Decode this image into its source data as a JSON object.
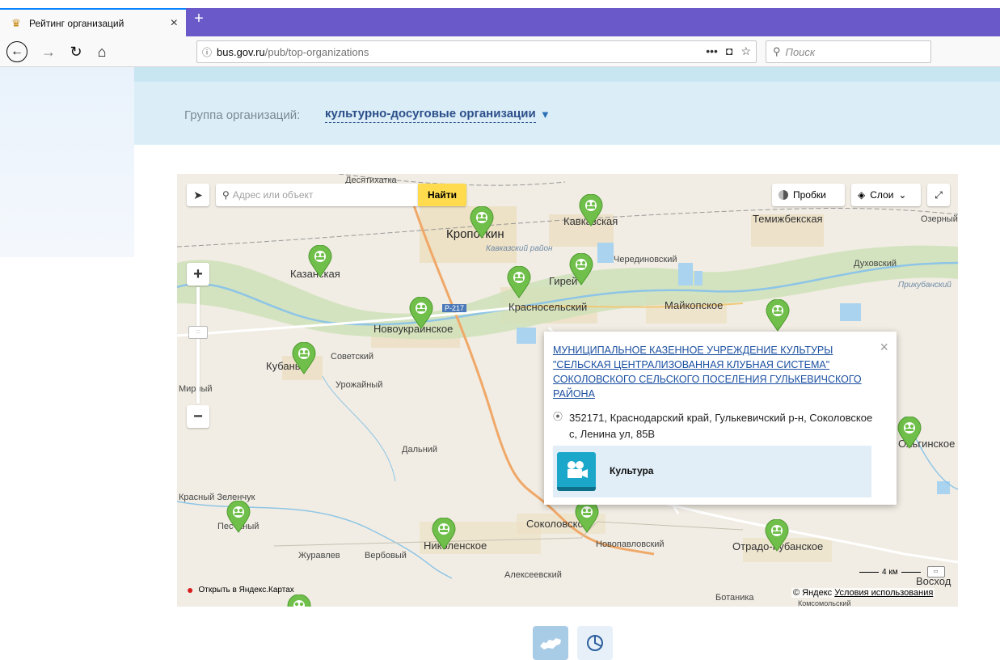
{
  "browser": {
    "tab_title": "Рейтинг организаций",
    "tab_close": "×",
    "new_tab": "+",
    "url_host": "bus.gov.ru",
    "url_path": "/pub/top-organizations",
    "url_more": "•••",
    "search_placeholder": "Поиск"
  },
  "group": {
    "label": "Группа организаций:",
    "value": "культурно-досуговые организации",
    "arrow": "▼"
  },
  "map": {
    "search_placeholder": "Адрес или объект",
    "find_button": "Найти",
    "traffic_label": "Пробки",
    "layers_label": "Слои",
    "open_in_yandex": "Открыть в Яндекс.Картах",
    "scale_label": "4 км",
    "copyright": "© Яндекс",
    "terms": "Условия использования",
    "places": [
      {
        "text": "Десятихатка",
        "cls": ""
      },
      {
        "text": "Кропоткин",
        "cls": "big"
      },
      {
        "text": "Кавказский район",
        "cls": "it"
      },
      {
        "text": "Кавказская",
        "cls": "md"
      },
      {
        "text": "Темижбекская",
        "cls": "md"
      },
      {
        "text": "Озерный",
        "cls": ""
      },
      {
        "text": "Казанская",
        "cls": "md"
      },
      {
        "text": "Гирей",
        "cls": "md"
      },
      {
        "text": "Черединовский",
        "cls": ""
      },
      {
        "text": "Духовский",
        "cls": ""
      },
      {
        "text": "Прикубанский",
        "cls": "it"
      },
      {
        "text": "Р-217",
        "cls": ""
      },
      {
        "text": "Красносельский",
        "cls": "md"
      },
      {
        "text": "Майкопское",
        "cls": "md"
      },
      {
        "text": "Новоукраинское",
        "cls": "md"
      },
      {
        "text": "Советский",
        "cls": ""
      },
      {
        "text": "Кубань",
        "cls": "md"
      },
      {
        "text": "Урожайный",
        "cls": ""
      },
      {
        "text": "Мирный",
        "cls": ""
      },
      {
        "text": "Дальний",
        "cls": ""
      },
      {
        "text": "Ольгинское",
        "cls": "md"
      },
      {
        "text": "Красный Зеленчук",
        "cls": ""
      },
      {
        "text": "Песчаный",
        "cls": ""
      },
      {
        "text": "Николенское",
        "cls": "md"
      },
      {
        "text": "Соколовское",
        "cls": "md"
      },
      {
        "text": "Новопавловский",
        "cls": ""
      },
      {
        "text": "Отрадо-Кубанское",
        "cls": "md"
      },
      {
        "text": "Журавлев",
        "cls": ""
      },
      {
        "text": "Вербовый",
        "cls": ""
      },
      {
        "text": "Алексеевский",
        "cls": ""
      },
      {
        "text": "Ботаника",
        "cls": ""
      },
      {
        "text": "Комсомольский",
        "cls": ""
      },
      {
        "text": "Восход",
        "cls": ""
      }
    ]
  },
  "popup": {
    "title": "МУНИЦИПАЛЬНОЕ КАЗЕННОЕ УЧРЕЖДЕНИЕ КУЛЬТУРЫ \"СЕЛЬСКАЯ ЦЕНТРАЛИЗОВАННАЯ КЛУБНАЯ СИСТЕМА\" СОКОЛОВСКОГО СЕЛЬСКОГО ПОСЕЛЕНИЯ ГУЛЬКЕВИЧСКОГО РАЙОНА",
    "address": "352171, Краснодарский край, Гулькевичский р-н, Соколовское с, Ленина ул, 85В",
    "category": "Культура",
    "close": "×"
  },
  "colors": {
    "marker": "#6fbf4a",
    "accent": "#2c4f8a",
    "tab_strip": "#6a59c9"
  }
}
